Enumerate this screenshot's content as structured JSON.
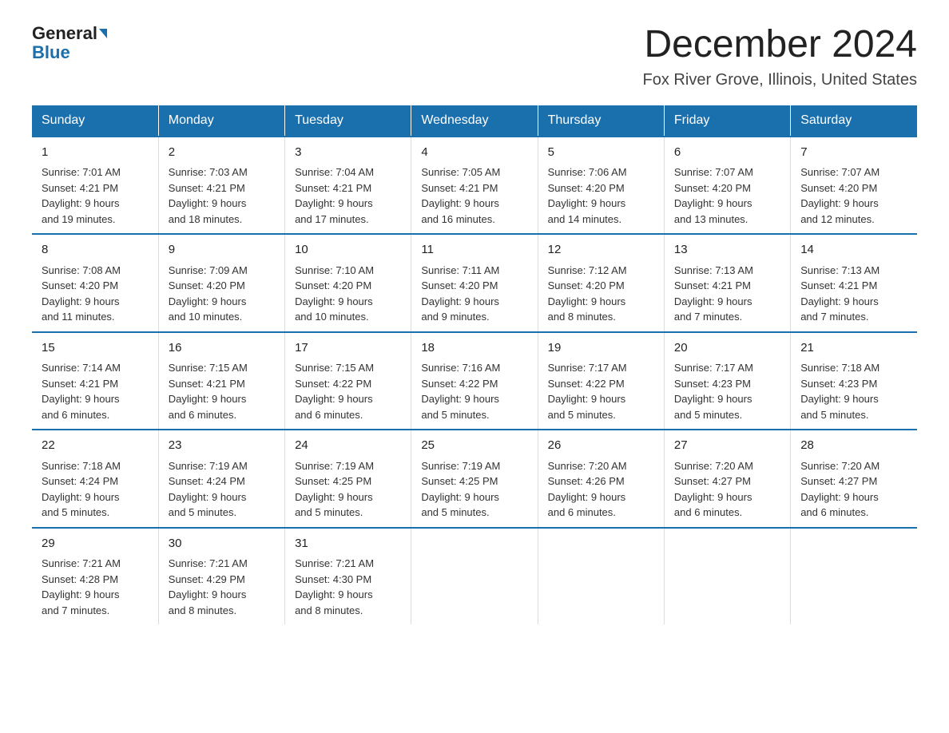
{
  "header": {
    "logo_general": "General",
    "logo_blue": "Blue",
    "month_title": "December 2024",
    "location": "Fox River Grove, Illinois, United States"
  },
  "days_of_week": [
    "Sunday",
    "Monday",
    "Tuesday",
    "Wednesday",
    "Thursday",
    "Friday",
    "Saturday"
  ],
  "weeks": [
    [
      {
        "day": "1",
        "sunrise": "7:01 AM",
        "sunset": "4:21 PM",
        "daylight": "9 hours and 19 minutes."
      },
      {
        "day": "2",
        "sunrise": "7:03 AM",
        "sunset": "4:21 PM",
        "daylight": "9 hours and 18 minutes."
      },
      {
        "day": "3",
        "sunrise": "7:04 AM",
        "sunset": "4:21 PM",
        "daylight": "9 hours and 17 minutes."
      },
      {
        "day": "4",
        "sunrise": "7:05 AM",
        "sunset": "4:21 PM",
        "daylight": "9 hours and 16 minutes."
      },
      {
        "day": "5",
        "sunrise": "7:06 AM",
        "sunset": "4:20 PM",
        "daylight": "9 hours and 14 minutes."
      },
      {
        "day": "6",
        "sunrise": "7:07 AM",
        "sunset": "4:20 PM",
        "daylight": "9 hours and 13 minutes."
      },
      {
        "day": "7",
        "sunrise": "7:07 AM",
        "sunset": "4:20 PM",
        "daylight": "9 hours and 12 minutes."
      }
    ],
    [
      {
        "day": "8",
        "sunrise": "7:08 AM",
        "sunset": "4:20 PM",
        "daylight": "9 hours and 11 minutes."
      },
      {
        "day": "9",
        "sunrise": "7:09 AM",
        "sunset": "4:20 PM",
        "daylight": "9 hours and 10 minutes."
      },
      {
        "day": "10",
        "sunrise": "7:10 AM",
        "sunset": "4:20 PM",
        "daylight": "9 hours and 10 minutes."
      },
      {
        "day": "11",
        "sunrise": "7:11 AM",
        "sunset": "4:20 PM",
        "daylight": "9 hours and 9 minutes."
      },
      {
        "day": "12",
        "sunrise": "7:12 AM",
        "sunset": "4:20 PM",
        "daylight": "9 hours and 8 minutes."
      },
      {
        "day": "13",
        "sunrise": "7:13 AM",
        "sunset": "4:21 PM",
        "daylight": "9 hours and 7 minutes."
      },
      {
        "day": "14",
        "sunrise": "7:13 AM",
        "sunset": "4:21 PM",
        "daylight": "9 hours and 7 minutes."
      }
    ],
    [
      {
        "day": "15",
        "sunrise": "7:14 AM",
        "sunset": "4:21 PM",
        "daylight": "9 hours and 6 minutes."
      },
      {
        "day": "16",
        "sunrise": "7:15 AM",
        "sunset": "4:21 PM",
        "daylight": "9 hours and 6 minutes."
      },
      {
        "day": "17",
        "sunrise": "7:15 AM",
        "sunset": "4:22 PM",
        "daylight": "9 hours and 6 minutes."
      },
      {
        "day": "18",
        "sunrise": "7:16 AM",
        "sunset": "4:22 PM",
        "daylight": "9 hours and 5 minutes."
      },
      {
        "day": "19",
        "sunrise": "7:17 AM",
        "sunset": "4:22 PM",
        "daylight": "9 hours and 5 minutes."
      },
      {
        "day": "20",
        "sunrise": "7:17 AM",
        "sunset": "4:23 PM",
        "daylight": "9 hours and 5 minutes."
      },
      {
        "day": "21",
        "sunrise": "7:18 AM",
        "sunset": "4:23 PM",
        "daylight": "9 hours and 5 minutes."
      }
    ],
    [
      {
        "day": "22",
        "sunrise": "7:18 AM",
        "sunset": "4:24 PM",
        "daylight": "9 hours and 5 minutes."
      },
      {
        "day": "23",
        "sunrise": "7:19 AM",
        "sunset": "4:24 PM",
        "daylight": "9 hours and 5 minutes."
      },
      {
        "day": "24",
        "sunrise": "7:19 AM",
        "sunset": "4:25 PM",
        "daylight": "9 hours and 5 minutes."
      },
      {
        "day": "25",
        "sunrise": "7:19 AM",
        "sunset": "4:25 PM",
        "daylight": "9 hours and 5 minutes."
      },
      {
        "day": "26",
        "sunrise": "7:20 AM",
        "sunset": "4:26 PM",
        "daylight": "9 hours and 6 minutes."
      },
      {
        "day": "27",
        "sunrise": "7:20 AM",
        "sunset": "4:27 PM",
        "daylight": "9 hours and 6 minutes."
      },
      {
        "day": "28",
        "sunrise": "7:20 AM",
        "sunset": "4:27 PM",
        "daylight": "9 hours and 6 minutes."
      }
    ],
    [
      {
        "day": "29",
        "sunrise": "7:21 AM",
        "sunset": "4:28 PM",
        "daylight": "9 hours and 7 minutes."
      },
      {
        "day": "30",
        "sunrise": "7:21 AM",
        "sunset": "4:29 PM",
        "daylight": "9 hours and 8 minutes."
      },
      {
        "day": "31",
        "sunrise": "7:21 AM",
        "sunset": "4:30 PM",
        "daylight": "9 hours and 8 minutes."
      },
      null,
      null,
      null,
      null
    ]
  ]
}
